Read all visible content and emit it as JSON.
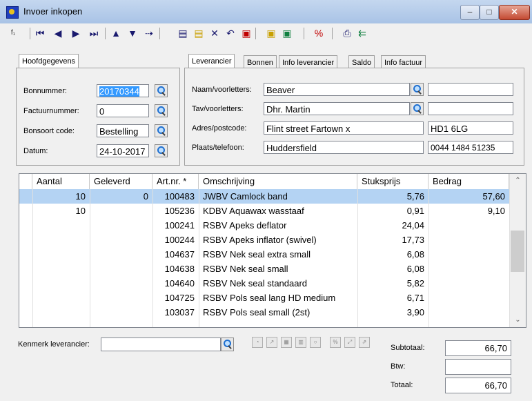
{
  "window": {
    "title": "Invoer inkopen"
  },
  "left_panel": {
    "tab": "Hoofdgegevens",
    "fields": [
      {
        "label": "Bonnummer:",
        "value": "20170344"
      },
      {
        "label": "Factuurnummer:",
        "value": "0"
      },
      {
        "label": "Bonsoort code:",
        "value": "Bestelling"
      },
      {
        "label": "Datum:",
        "value": "24-10-2017"
      }
    ]
  },
  "right_panel": {
    "tabs": [
      "Leverancier",
      "Bonnen",
      "Info leverancier",
      "Saldo",
      "Info factuur"
    ],
    "fields": [
      {
        "label": "Naam/voorletters:",
        "value": "Beaver",
        "extra": ""
      },
      {
        "label": "Tav/voorletters:",
        "value": "Dhr. Martin",
        "extra": ""
      },
      {
        "label": "Adres/postcode:",
        "value": "Flint street Fartown x",
        "extra": "HD1 6LG"
      },
      {
        "label": "Plaats/telefoon:",
        "value": "Huddersfield",
        "extra": "0044 1484 51235"
      }
    ]
  },
  "grid": {
    "columns": [
      "Aantal",
      "Geleverd",
      "Art.nr. *",
      "Omschrijving",
      "Stuksprijs",
      "Bedrag"
    ],
    "rows": [
      {
        "aantal": "10",
        "geleverd": "0",
        "artnr": "100483",
        "omschrijving": "JWBV Camlock band",
        "stuksprijs": "5,76",
        "bedrag": "57,60"
      },
      {
        "aantal": "10",
        "geleverd": "",
        "artnr": "105236",
        "omschrijving": "KDBV Aquawax wasstaaf",
        "stuksprijs": "0,91",
        "bedrag": "9,10"
      },
      {
        "aantal": "",
        "geleverd": "",
        "artnr": "100241",
        "omschrijving": "RSBV Apeks deflator",
        "stuksprijs": "24,04",
        "bedrag": ""
      },
      {
        "aantal": "",
        "geleverd": "",
        "artnr": "100244",
        "omschrijving": "RSBV Apeks inflator (swivel)",
        "stuksprijs": "17,73",
        "bedrag": ""
      },
      {
        "aantal": "",
        "geleverd": "",
        "artnr": "104637",
        "omschrijving": "RSBV Nek seal extra small",
        "stuksprijs": "6,08",
        "bedrag": ""
      },
      {
        "aantal": "",
        "geleverd": "",
        "artnr": "104638",
        "omschrijving": "RSBV Nek seal small",
        "stuksprijs": "6,08",
        "bedrag": ""
      },
      {
        "aantal": "",
        "geleverd": "",
        "artnr": "104640",
        "omschrijving": "RSBV Nek seal standaard",
        "stuksprijs": "5,82",
        "bedrag": ""
      },
      {
        "aantal": "",
        "geleverd": "",
        "artnr": "104725",
        "omschrijving": "RSBV Pols seal lang HD medium",
        "stuksprijs": "6,71",
        "bedrag": ""
      },
      {
        "aantal": "",
        "geleverd": "",
        "artnr": "103037",
        "omschrijving": "RSBV Pols seal small (2st)",
        "stuksprijs": "3,90",
        "bedrag": ""
      }
    ]
  },
  "bottom": {
    "kenmerk_label": "Kenmerk leverancier:",
    "kenmerk_value": "",
    "subtotaal_label": "Subtotaal:",
    "subtotaal_value": "66,70",
    "btw_label": "Btw:",
    "btw_value": "",
    "totaal_label": "Totaal:",
    "totaal_value": "66,70"
  },
  "colors": {
    "selection": "#b4d3f3",
    "highlight": "#3399ff",
    "titlebar": "#a9c3e6"
  }
}
